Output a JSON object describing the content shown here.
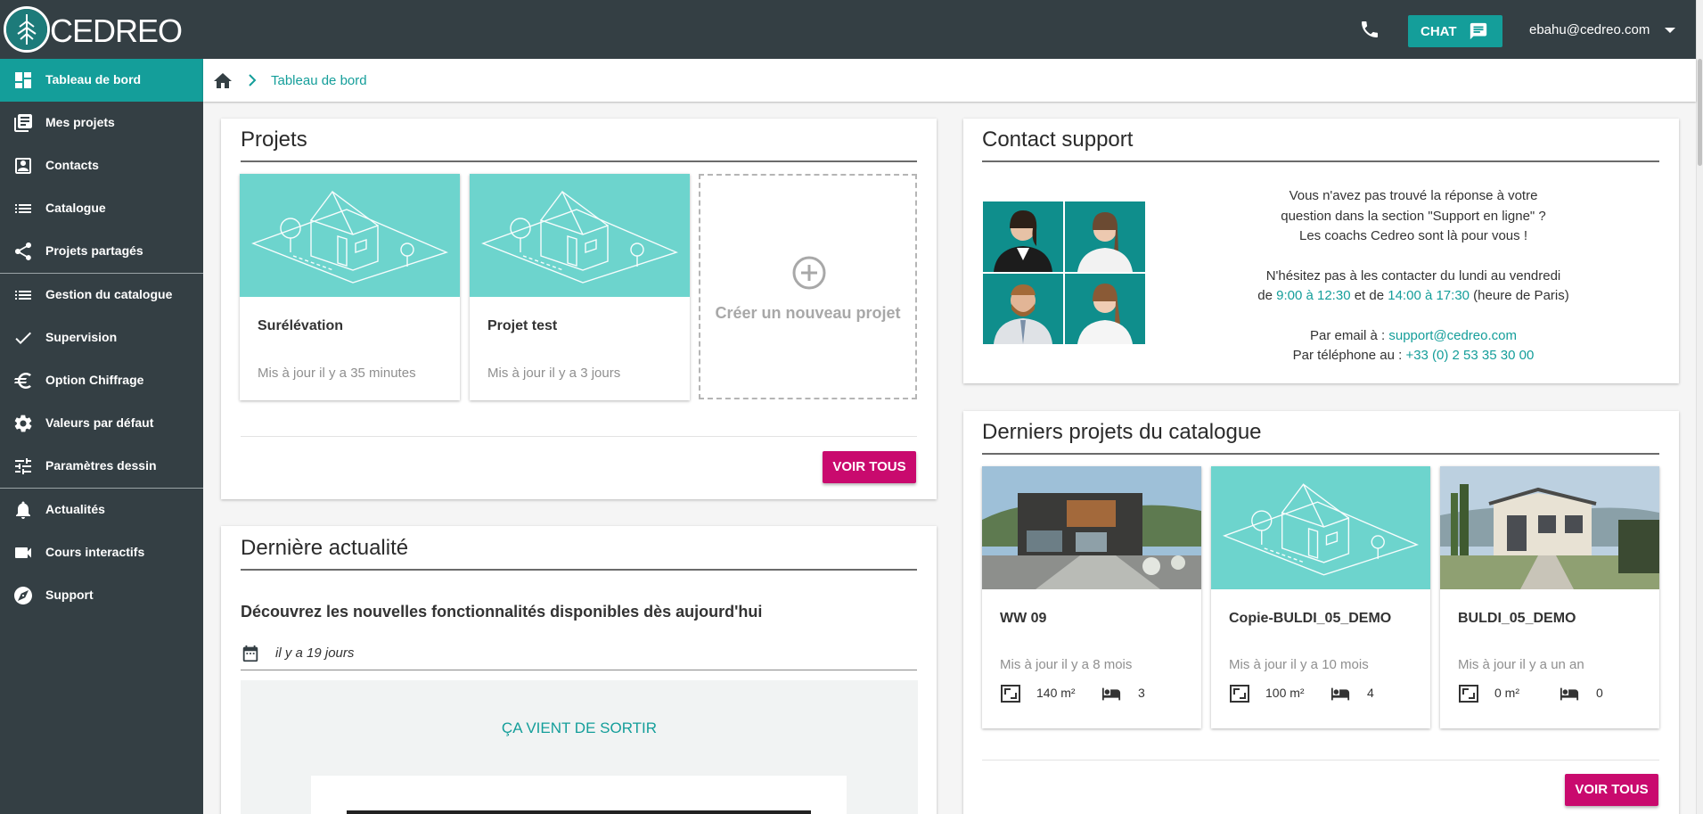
{
  "app": {
    "logo_text": "CEDREO"
  },
  "topbar": {
    "chat_label": "CHAT",
    "user_email": "ebahu@cedreo.com"
  },
  "sidebar": {
    "items": [
      {
        "label": "Tableau de bord",
        "icon": "dashboard-icon"
      },
      {
        "label": "Mes projets",
        "icon": "projects-icon"
      },
      {
        "label": "Contacts",
        "icon": "contacts-icon"
      },
      {
        "label": "Catalogue",
        "icon": "list-icon"
      },
      {
        "label": "Projets partagés",
        "icon": "share-icon"
      },
      {
        "label": "Gestion du catalogue",
        "icon": "list-icon"
      },
      {
        "label": "Supervision",
        "icon": "check-icon"
      },
      {
        "label": "Option Chiffrage",
        "icon": "euro-icon"
      },
      {
        "label": "Valeurs par défaut",
        "icon": "gear-icon"
      },
      {
        "label": "Paramètres dessin",
        "icon": "sliders-icon"
      },
      {
        "label": "Actualités",
        "icon": "bell-icon"
      },
      {
        "label": "Cours interactifs",
        "icon": "video-icon"
      },
      {
        "label": "Support",
        "icon": "compass-icon"
      }
    ]
  },
  "breadcrumb": {
    "current": "Tableau de bord"
  },
  "projects": {
    "title": "Projets",
    "items": [
      {
        "name": "Surélévation",
        "updated": "Mis à jour il y a 35 minutes"
      },
      {
        "name": "Projet test",
        "updated": "Mis à jour il y a 3 jours"
      }
    ],
    "new_label": "Créer un nouveau projet",
    "see_all": "VOIR TOUS"
  },
  "support": {
    "title": "Contact support",
    "line1": "Vous n'avez pas trouvé la réponse à votre",
    "line2": "question dans la section \"Support en ligne\" ?",
    "line3": "Les coachs Cedreo sont là pour vous !",
    "line4": "N'hésitez pas à les contacter du lundi au vendredi",
    "hours_pre": "de ",
    "hours_am": "9:00 à 12:30",
    "hours_mid": " et de ",
    "hours_pm": "14:00 à 17:30",
    "hours_post": " (heure de Paris)",
    "email_label": "Par email à : ",
    "email": "support@cedreo.com",
    "phone_label": "Par téléphone au : ",
    "phone": "+33 (0) 2 53 35 30 00"
  },
  "news": {
    "title": "Dernière actualité",
    "headline": "Découvrez les nouvelles fonctionnalités disponibles dès aujourd'hui",
    "date": "il y a 19 jours",
    "banner": "ÇA VIENT DE SORTIR"
  },
  "catalog": {
    "title": "Derniers projets du catalogue",
    "items": [
      {
        "name": "WW 09",
        "updated": "Mis à jour il y a 8 mois",
        "area": "140 m²",
        "bedrooms": "3"
      },
      {
        "name": "Copie-BULDI_05_DEMO",
        "updated": "Mis à jour il y a 10 mois",
        "area": "100 m²",
        "bedrooms": "4"
      },
      {
        "name": "BULDI_05_DEMO",
        "updated": "Mis à jour il y a un an",
        "area": "0 m²",
        "bedrooms": "0"
      }
    ],
    "see_all": "VOIR TOUS"
  },
  "colors": {
    "accent": "#149e9a",
    "sidebar": "#343f44",
    "button": "#c90a6e",
    "thumb": "#6dd4cd"
  }
}
